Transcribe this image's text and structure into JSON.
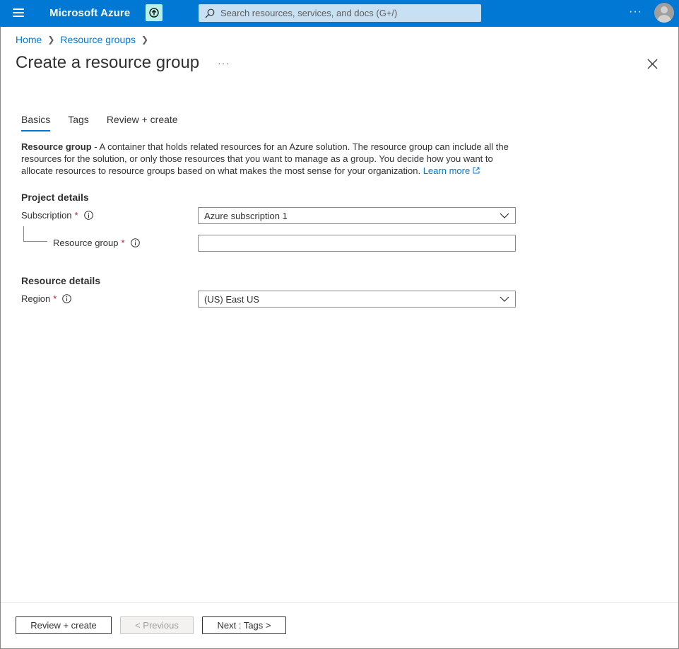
{
  "topbar": {
    "brand": "Microsoft Azure",
    "search_placeholder": "Search resources, services, and docs (G+/)",
    "more_label": "···"
  },
  "breadcrumb": [
    "Home",
    "Resource groups"
  ],
  "page": {
    "title": "Create a resource group",
    "more_label": "···"
  },
  "tabs": [
    {
      "label": "Basics",
      "active": true
    },
    {
      "label": "Tags",
      "active": false
    },
    {
      "label": "Review + create",
      "active": false
    }
  ],
  "description": {
    "bold": "Resource group",
    "text": " - A container that holds related resources for an Azure solution. The resource group can include all the resources for the solution, or only those resources that you want to manage as a group. You decide how you want to allocate resources to resource groups based on what makes the most sense for your organization. ",
    "link": "Learn more"
  },
  "project_details": {
    "title": "Project details",
    "subscription_label": "Subscription",
    "subscription_value": "Azure subscription 1",
    "resource_group_label": "Resource group",
    "resource_group_value": ""
  },
  "resource_details": {
    "title": "Resource details",
    "region_label": "Region",
    "region_value": "(US) East US"
  },
  "required_marker": "*",
  "footer": {
    "review_create": "Review + create",
    "previous": "< Previous",
    "next": "Next : Tags >"
  },
  "colors": {
    "accent": "#0078d4",
    "required": "#a4262c"
  }
}
